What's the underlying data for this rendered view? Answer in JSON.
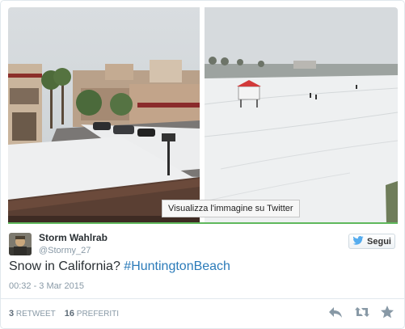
{
  "media": {
    "view_tooltip": "Visualizza l'immagine su Twitter"
  },
  "user": {
    "name": "Storm Wahlrab",
    "handle": "@Stormy_27"
  },
  "follow_label": "Segui",
  "tweet": {
    "text": "Snow in California? ",
    "hashtag": "#HuntingtonBeach",
    "timestamp": "00:32 - 3 Mar 2015"
  },
  "stats": {
    "retweets_count": "3",
    "retweets_label": "RETWEET",
    "favorites_count": "16",
    "favorites_label": "PREFERITI"
  },
  "icons": {
    "reply": "reply-icon",
    "retweet": "retweet-icon",
    "favorite": "star-icon",
    "follow": "twitter-bird-icon"
  },
  "colors": {
    "hashtag": "#2b7bb9",
    "muted": "#8899a6",
    "media_accent": "#5fb85c"
  }
}
